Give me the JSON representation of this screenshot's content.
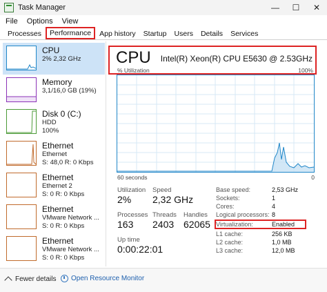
{
  "window": {
    "title": "Task Manager",
    "minimize": "—",
    "maximize": "☐",
    "close": "✕"
  },
  "menu": [
    "File",
    "Options",
    "View"
  ],
  "tabs": [
    "Processes",
    "Performance",
    "App history",
    "Startup",
    "Users",
    "Details",
    "Services"
  ],
  "sidebar": {
    "items": [
      {
        "title": "CPU",
        "sub1": "2% 2,32 GHz",
        "sub2": "",
        "sub3": ""
      },
      {
        "title": "Memory",
        "sub1": "3,1/16,0 GB (19%)",
        "sub2": "",
        "sub3": ""
      },
      {
        "title": "Disk 0 (C:)",
        "sub1": "HDD",
        "sub2": "100%",
        "sub3": ""
      },
      {
        "title": "Ethernet",
        "sub1": "Ethernet",
        "sub2": "S: 48,0 R: 0 Kbps",
        "sub3": ""
      },
      {
        "title": "Ethernet",
        "sub1": "Ethernet 2",
        "sub2": "S: 0 R: 0 Kbps",
        "sub3": ""
      },
      {
        "title": "Ethernet",
        "sub1": "VMware Network ...",
        "sub2": "S: 0 R: 0 Kbps",
        "sub3": ""
      },
      {
        "title": "Ethernet",
        "sub1": "VMware Network ...",
        "sub2": "S: 0 R: 0 Kbps",
        "sub3": ""
      }
    ]
  },
  "main": {
    "title": "CPU",
    "model": "Intel(R) Xeon(R) CPU E5630 @ 2.53GHz",
    "util_label": "% Utilization",
    "util_max": "100%",
    "axis_left": "60 seconds",
    "axis_right": "0",
    "stats": {
      "utilization_label": "Utilization",
      "utilization_value": "2%",
      "speed_label": "Speed",
      "speed_value": "2,32 GHz",
      "processes_label": "Processes",
      "processes_value": "163",
      "threads_label": "Threads",
      "threads_value": "2403",
      "handles_label": "Handles",
      "handles_value": "62065",
      "uptime_label": "Up time",
      "uptime_value": "0:00:22:01"
    },
    "specs": [
      {
        "key": "Base speed:",
        "value": "2,53 GHz"
      },
      {
        "key": "Sockets:",
        "value": "1"
      },
      {
        "key": "Cores:",
        "value": "4"
      },
      {
        "key": "Logical processors:",
        "value": "8"
      },
      {
        "key": "Virtualization:",
        "value": "Enabled"
      },
      {
        "key": "L1 cache:",
        "value": "256 KB"
      },
      {
        "key": "L2 cache:",
        "value": "1,0 MB"
      },
      {
        "key": "L3 cache:",
        "value": "12,0 MB"
      }
    ]
  },
  "footer": {
    "fewer_details": "Fewer details",
    "open_resource_monitor": "Open Resource Monitor"
  },
  "colors": {
    "cpu": "#1f86c8",
    "memory": "#8b32b7",
    "disk": "#4a9a36",
    "ethernet": "#c06a2b",
    "highlight": "#dd2222"
  }
}
